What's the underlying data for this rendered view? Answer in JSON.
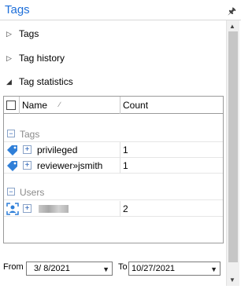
{
  "panel": {
    "title": "Tags"
  },
  "sections": [
    {
      "label": "Tags",
      "expanded": false
    },
    {
      "label": "Tag history",
      "expanded": false
    },
    {
      "label": "Tag statistics",
      "expanded": true
    }
  ],
  "grid": {
    "columns": {
      "name": "Name",
      "count": "Count"
    },
    "groups": [
      {
        "label": "Tags",
        "rows": [
          {
            "name": "privileged",
            "count": "1",
            "icon": "tag-icon"
          },
          {
            "name": "reviewer»jsmith",
            "count": "1",
            "icon": "tag-icon"
          }
        ]
      },
      {
        "label": "Users",
        "rows": [
          {
            "name": "",
            "count": "2",
            "icon": "user-icon"
          }
        ]
      }
    ]
  },
  "dates": {
    "from_label": "From",
    "from_value": "3/  8/2021",
    "to_label": "To",
    "to_value": "10/27/2021"
  },
  "colors": {
    "title": "#1e6fd9",
    "tag_icon": "#2f7fd8",
    "user_icon": "#2f7fd8"
  }
}
